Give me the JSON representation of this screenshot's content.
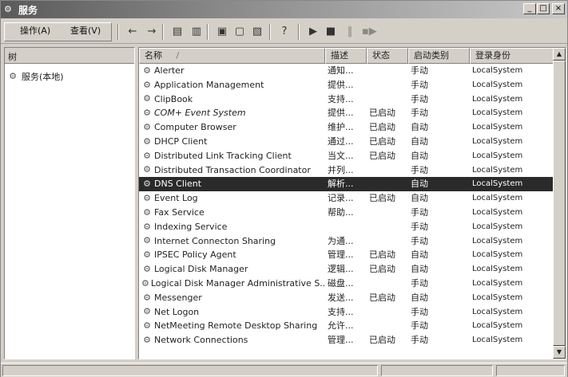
{
  "window": {
    "title": "服务",
    "minimize_glyph": "_",
    "maximize_glyph": "□",
    "close_glyph": "×"
  },
  "menu": {
    "action_label": "操作(A)",
    "view_label": "查看(V)"
  },
  "toolbar": {
    "icons": [
      "back-arrow-icon",
      "forward-arrow-icon",
      "up-folder-icon",
      "show-hide-tree-icon",
      "properties-icon",
      "refresh-icon",
      "export-list-icon",
      "help-icon",
      "start-service-icon",
      "stop-service-icon",
      "pause-service-icon",
      "restart-service-icon"
    ]
  },
  "tree": {
    "header": "树",
    "root_label": "服务(本地)"
  },
  "list": {
    "columns": {
      "name": "名称",
      "description": "描述",
      "status": "状态",
      "startup": "启动类别",
      "logon": "登录身份"
    },
    "sort_indicator": "/",
    "selected_index": 8,
    "rows": [
      {
        "name": "Alerter",
        "description": "通知...",
        "status": "",
        "startup": "手动",
        "logon": "LocalSystem"
      },
      {
        "name": "Application Management",
        "description": "提供...",
        "status": "",
        "startup": "手动",
        "logon": "LocalSystem"
      },
      {
        "name": "ClipBook",
        "description": "支持...",
        "status": "",
        "startup": "手动",
        "logon": "LocalSystem"
      },
      {
        "name": "COM+ Event System",
        "description": "提供...",
        "status": "已启动",
        "startup": "手动",
        "logon": "LocalSystem"
      },
      {
        "name": "Computer Browser",
        "description": "维护...",
        "status": "已启动",
        "startup": "自动",
        "logon": "LocalSystem"
      },
      {
        "name": "DHCP Client",
        "description": "通过...",
        "status": "已启动",
        "startup": "自动",
        "logon": "LocalSystem"
      },
      {
        "name": "Distributed Link Tracking Client",
        "description": "当文...",
        "status": "已启动",
        "startup": "自动",
        "logon": "LocalSystem"
      },
      {
        "name": "Distributed Transaction Coordinator",
        "description": "并列...",
        "status": "",
        "startup": "手动",
        "logon": "LocalSystem"
      },
      {
        "name": "DNS Client",
        "description": "解析...",
        "status": "",
        "startup": "自动",
        "logon": "LocalSystem"
      },
      {
        "name": "Event Log",
        "description": "记录...",
        "status": "已启动",
        "startup": "自动",
        "logon": "LocalSystem"
      },
      {
        "name": "Fax Service",
        "description": "帮助...",
        "status": "",
        "startup": "手动",
        "logon": "LocalSystem"
      },
      {
        "name": "Indexing Service",
        "description": "",
        "status": "",
        "startup": "手动",
        "logon": "LocalSystem"
      },
      {
        "name": "Internet Connecton Sharing",
        "description": "为通...",
        "status": "",
        "startup": "手动",
        "logon": "LocalSystem"
      },
      {
        "name": "IPSEC Policy Agent",
        "description": "管理...",
        "status": "已启动",
        "startup": "自动",
        "logon": "LocalSystem"
      },
      {
        "name": "Logical Disk Manager",
        "description": "逻辑...",
        "status": "已启动",
        "startup": "自动",
        "logon": "LocalSystem"
      },
      {
        "name": "Logical Disk Manager Administrative S...",
        "description": "磁盘...",
        "status": "",
        "startup": "手动",
        "logon": "LocalSystem"
      },
      {
        "name": "Messenger",
        "description": "发送...",
        "status": "已启动",
        "startup": "自动",
        "logon": "LocalSystem"
      },
      {
        "name": "Net Logon",
        "description": "支持...",
        "status": "",
        "startup": "手动",
        "logon": "LocalSystem"
      },
      {
        "name": "NetMeeting Remote Desktop Sharing",
        "description": "允许...",
        "status": "",
        "startup": "手动",
        "logon": "LocalSystem"
      },
      {
        "name": "Network Connections",
        "description": "管理...",
        "status": "已启动",
        "startup": "手动",
        "logon": "LocalSystem"
      }
    ],
    "italic_rows": [
      3
    ]
  },
  "colors": {
    "selection_bg": "#2a2a2a",
    "selection_fg": "#ffffff",
    "window_bg": "#d4d0c8"
  }
}
